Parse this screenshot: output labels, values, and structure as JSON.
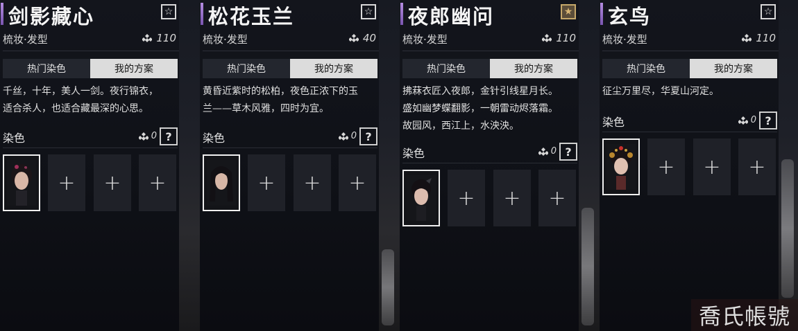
{
  "panels": [
    {
      "title": "剑影藏心",
      "favorite_icon": "star-outline-icon",
      "subtitle": "梳妆·发型",
      "cost": "110",
      "tabs": {
        "hot": "热门染色",
        "mine": "我的方案"
      },
      "desc": [
        "千丝，十年，美人一剑。夜行锦衣，",
        "适合杀人，也适合藏最深的心思。"
      ],
      "dye_label": "染色",
      "dye_count": "0",
      "help_label": "?",
      "add_label": "+"
    },
    {
      "title": "松花玉兰",
      "favorite_icon": "star-outline-icon",
      "subtitle": "梳妆·发型",
      "cost": "40",
      "tabs": {
        "hot": "热门染色",
        "mine": "我的方案"
      },
      "desc": [
        "黄昏近紫时的松柏，夜色正浓下的玉",
        "兰——草木风雅，四时为宜。"
      ],
      "dye_label": "染色",
      "dye_count": "0",
      "help_label": "?",
      "add_label": "+"
    },
    {
      "title": "夜郎幽问",
      "favorite_icon": "star-filled-icon",
      "subtitle": "梳妆·发型",
      "cost": "110",
      "tabs": {
        "hot": "热门染色",
        "mine": "我的方案"
      },
      "desc": [
        "拂菻衣匠入夜郎，金针引线星月长。",
        "盛如幽梦蝶翻影，一朝雷动烬落霜。",
        "故园风，西江上，水泱泱。"
      ],
      "dye_label": "染色",
      "dye_count": "0",
      "help_label": "?",
      "add_label": "+"
    },
    {
      "title": "玄鸟",
      "favorite_icon": "star-outline-icon",
      "subtitle": "梳妆·发型",
      "cost": "110",
      "tabs": {
        "hot": "热门染色",
        "mine": "我的方案"
      },
      "desc": [
        "征尘万里尽，华夏山河定。"
      ],
      "dye_label": "染色",
      "dye_count": "0",
      "help_label": "?",
      "add_label": "+"
    }
  ],
  "watermark": "喬氏帳號",
  "colors": {
    "accent_purple": "#9b6fd0",
    "tab_active": "#dcdcdc",
    "favorite_gold": "#c6a86a"
  }
}
